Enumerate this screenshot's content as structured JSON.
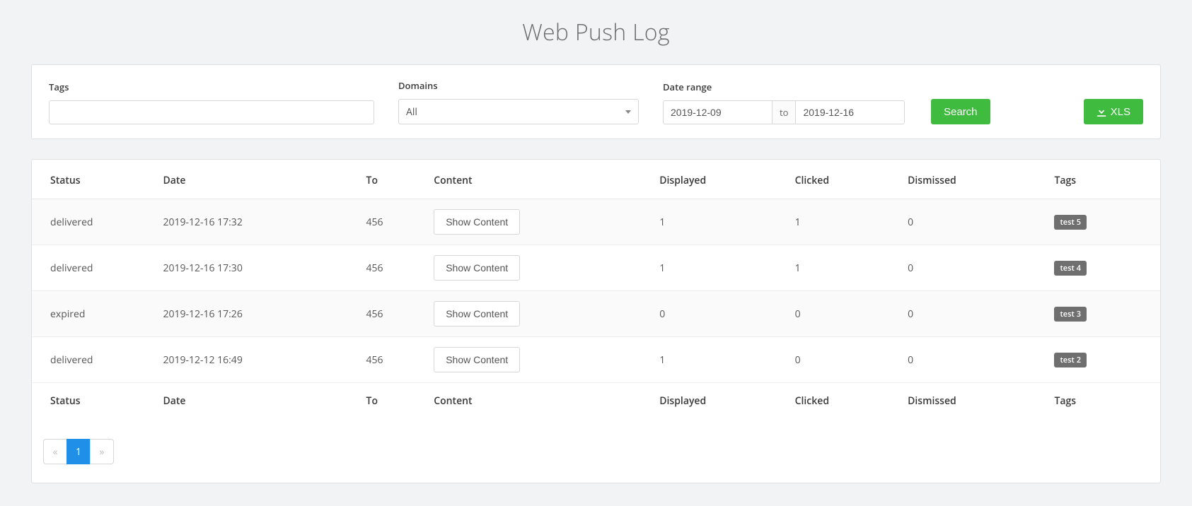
{
  "pageTitle": "Web Push Log",
  "filters": {
    "tags": {
      "label": "Tags",
      "value": ""
    },
    "domains": {
      "label": "Domains",
      "selected": "All"
    },
    "daterange": {
      "label": "Date range",
      "from": "2019-12-09",
      "to_label": "to",
      "to": "2019-12-16"
    }
  },
  "buttons": {
    "search": "Search",
    "xls": "XLS"
  },
  "table": {
    "headers": {
      "status": "Status",
      "date": "Date",
      "to": "To",
      "content": "Content",
      "displayed": "Displayed",
      "clicked": "Clicked",
      "dismissed": "Dismissed",
      "tags": "Tags"
    },
    "showContentLabel": "Show Content",
    "rows": [
      {
        "status": "delivered",
        "date": "2019-12-16 17:32",
        "to": "456",
        "displayed": "1",
        "clicked": "1",
        "dismissed": "0",
        "tag": "test 5"
      },
      {
        "status": "delivered",
        "date": "2019-12-16 17:30",
        "to": "456",
        "displayed": "1",
        "clicked": "1",
        "dismissed": "0",
        "tag": "test 4"
      },
      {
        "status": "expired",
        "date": "2019-12-16 17:26",
        "to": "456",
        "displayed": "0",
        "clicked": "0",
        "dismissed": "0",
        "tag": "test 3"
      },
      {
        "status": "delivered",
        "date": "2019-12-12 16:49",
        "to": "456",
        "displayed": "1",
        "clicked": "0",
        "dismissed": "0",
        "tag": "test 2"
      }
    ]
  },
  "pagination": {
    "prev": "«",
    "current": "1",
    "next": "»"
  }
}
